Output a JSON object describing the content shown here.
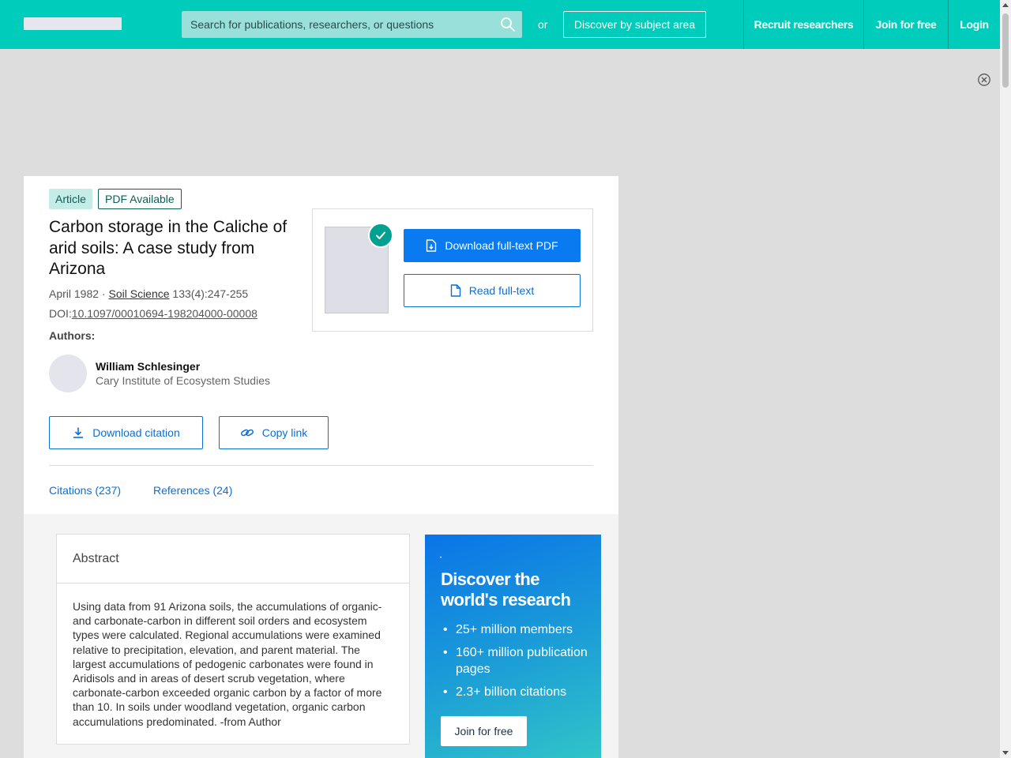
{
  "header": {
    "search_placeholder": "Search for publications, researchers, or questions",
    "or_label": "or",
    "discover_label": "Discover by subject area",
    "nav": {
      "recruit": "Recruit researchers",
      "join": "Join for free",
      "login": "Login"
    }
  },
  "ad": {
    "close_icon": "close-circle-icon"
  },
  "publication": {
    "badges": {
      "type": "Article",
      "pdf": "PDF Available"
    },
    "title": "Carbon storage in the Caliche of arid soils: A case study from Arizona",
    "date": "April 1982",
    "separator": " · ",
    "journal": "Soil Science",
    "volume": " 133(4):247-255",
    "doi_label": "DOI:",
    "doi": "10.1097/00010694-198204000-00008",
    "authors_label": "Authors:",
    "author": {
      "name": "William Schlesinger",
      "institution": "Cary Institute of Ecosystem Studies"
    }
  },
  "pdf_box": {
    "download_label": "Download full-text PDF",
    "read_label": "Read full-text"
  },
  "actions": {
    "cite_label": "Download citation",
    "copy_label": "Copy link"
  },
  "tabs": {
    "citations": "Citations (237)",
    "references": "References (24)"
  },
  "abstract": {
    "heading": "Abstract",
    "text": "Using data from 91 Arizona soils, the accumulations of organic- and carbonate-carbon in different soil orders and ecosystem types were calculated. Regional accumulations were examined relative to precipitation, elevation, and parent material. The largest accumulations of pedogenic carbonates were found in Aridisols and in areas of desert scrub vegetation, where carbonate-carbon exceeded organic carbon by a factor of more than 10. In soils under woodland vegetation, organic carbon accumulations predominated. -from Author"
  },
  "promo": {
    "title": "Discover the world's research",
    "items": [
      "25+ million members",
      "160+ million publication pages",
      "2.3+ billion citations"
    ],
    "join_label": "Join for free"
  },
  "colors": {
    "brand": "#00ccbb",
    "link": "#0a6fd6",
    "primary_button": "#0a7af0"
  }
}
